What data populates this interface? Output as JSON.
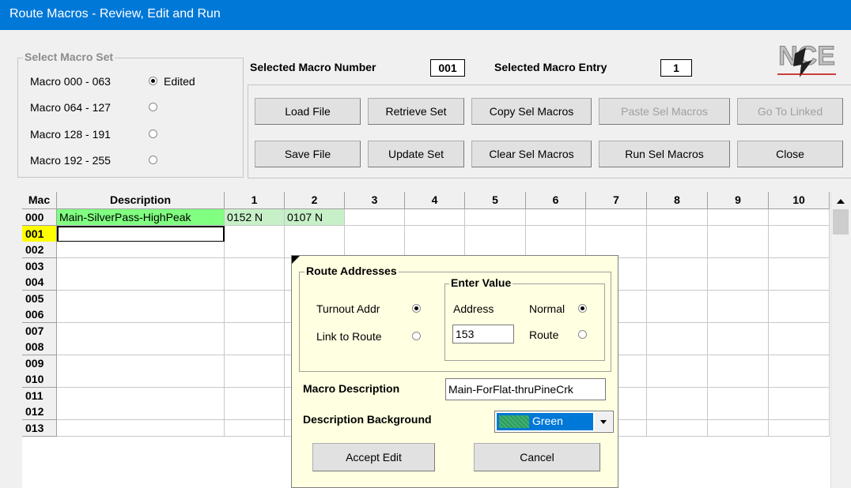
{
  "window": {
    "title": "Route Macros - Review, Edit and Run"
  },
  "macro_set": {
    "label": "Select Macro Set",
    "options": [
      {
        "label": "Macro 000 - 063",
        "selected": true,
        "status": "Edited"
      },
      {
        "label": "Macro 064 - 127",
        "selected": false
      },
      {
        "label": "Macro 128 - 191",
        "selected": false
      },
      {
        "label": "Macro 192 - 255",
        "selected": false
      }
    ]
  },
  "selected": {
    "number_label": "Selected Macro Number",
    "number_value": "001",
    "entry_label": "Selected Macro Entry",
    "entry_value": "1"
  },
  "buttons": {
    "load_file": "Load File",
    "retrieve_set": "Retrieve Set",
    "copy_sel": "Copy Sel Macros",
    "paste_sel": "Paste Sel Macros",
    "go_linked": "Go To Linked",
    "save_file": "Save File",
    "update_set": "Update Set",
    "clear_sel": "Clear Sel Macros",
    "run_sel": "Run Sel Macros",
    "close": "Close"
  },
  "logo": {
    "text": "NCE"
  },
  "grid": {
    "headers": [
      "Mac",
      "Description",
      "1",
      "2",
      "3",
      "4",
      "5",
      "6",
      "7",
      "8",
      "9",
      "10"
    ],
    "rows": [
      {
        "mac": "000",
        "description": "Main-SilverPass-HighPeak",
        "desc_color": "#80ff80",
        "entries": [
          "0152 N",
          "0107 N"
        ],
        "entry_color": "#c8f0c8"
      },
      {
        "mac": "001",
        "description": "",
        "selected": true
      },
      {
        "mac": "002"
      },
      {
        "mac": "003"
      },
      {
        "mac": "004"
      },
      {
        "mac": "005"
      },
      {
        "mac": "006"
      },
      {
        "mac": "007"
      },
      {
        "mac": "008"
      },
      {
        "mac": "009"
      },
      {
        "mac": "010"
      },
      {
        "mac": "011"
      },
      {
        "mac": "012"
      },
      {
        "mac": "013"
      }
    ]
  },
  "editor": {
    "route_addresses_label": "Route Addresses",
    "turnout_addr_label": "Turnout Addr",
    "link_to_route_label": "Link to Route",
    "turnout_selected": true,
    "enter_value_label": "Enter Value",
    "address_label": "Address",
    "address_value": "153",
    "normal_label": "Normal",
    "route_label": "Route",
    "normal_selected": true,
    "macro_description_label": "Macro Description",
    "macro_description_value": "Main-ForFlat-thruPineCrk",
    "background_label": "Description Background",
    "background_value": "Green",
    "background_color": "#3cb371",
    "accept_label": "Accept Edit",
    "cancel_label": "Cancel"
  },
  "colors": {
    "title_bar": "#0078d7",
    "selected_row_header": "#ffff00"
  }
}
